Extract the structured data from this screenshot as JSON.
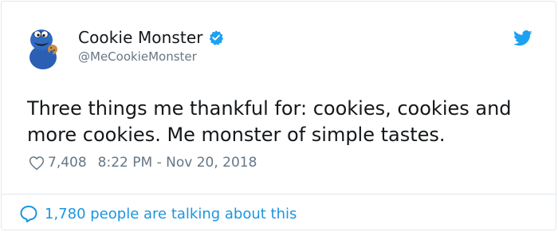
{
  "tweet": {
    "author": {
      "name": "Cookie Monster",
      "handle": "@MeCookieMonster",
      "verified": true
    },
    "text": "Three things me thankful for: cookies, cookies and more cookies. Me monster of simple tastes.",
    "likes": "7,408",
    "timestamp": "8:22 PM - Nov 20, 2018"
  },
  "footer": {
    "conversation": "1,780 people are talking about this"
  },
  "colors": {
    "accent": "#1da1f2",
    "link": "#1b95e0",
    "muted": "#657786",
    "text": "#14171a",
    "border": "#e1e8ed"
  },
  "icons": {
    "avatar": "cookie-monster-avatar",
    "verified": "verified-badge-icon",
    "brand": "twitter-bird-icon",
    "like": "heart-icon",
    "reply": "reply-bubble-icon"
  }
}
